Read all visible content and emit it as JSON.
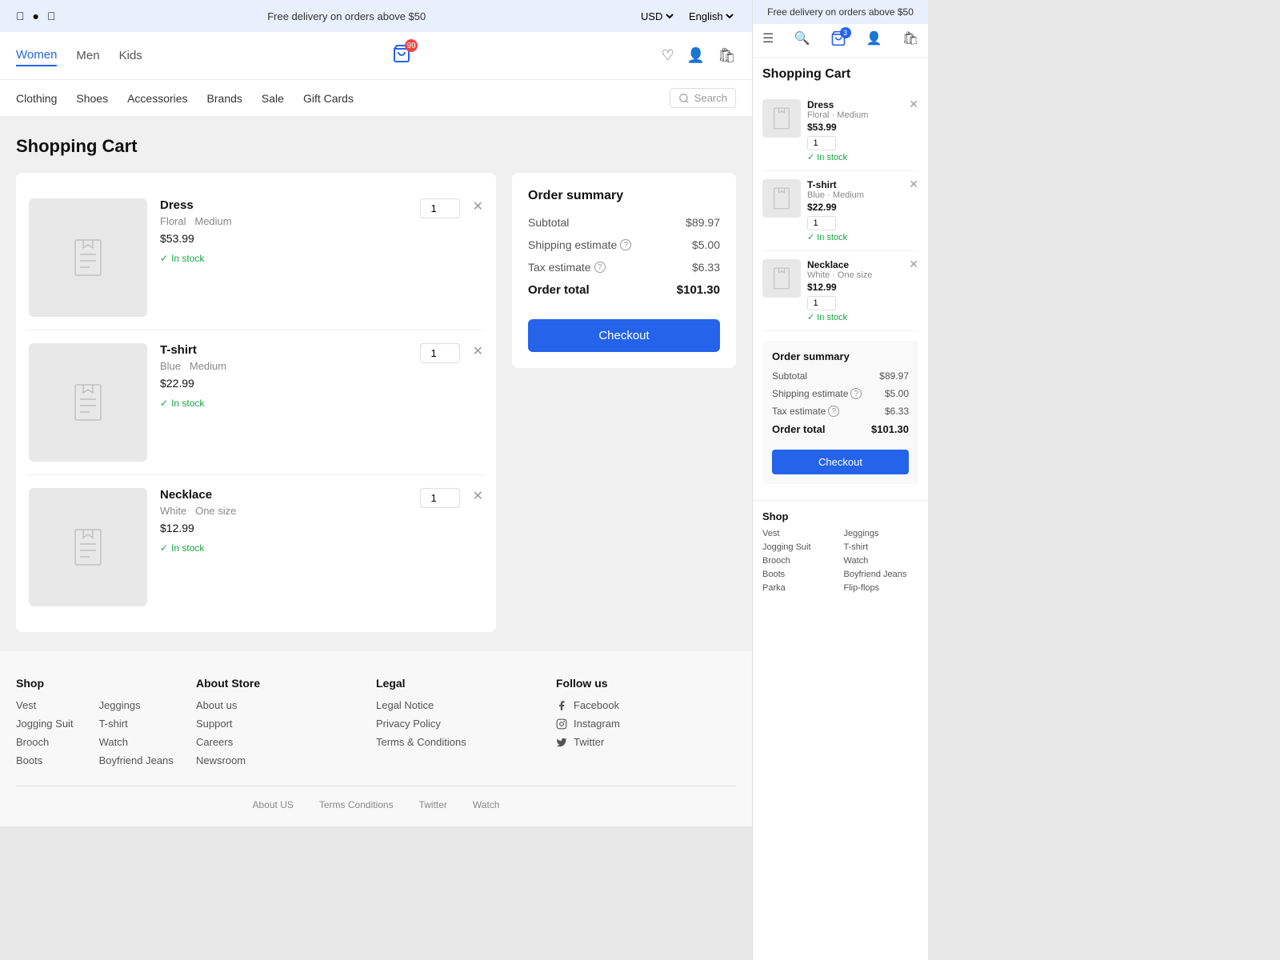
{
  "topbar": {
    "promo": "Free delivery on orders above $50",
    "currency": "USD",
    "language": "English",
    "social": [
      "facebook",
      "instagram",
      "twitter"
    ]
  },
  "nav": {
    "tabs": [
      "Women",
      "Men",
      "Kids"
    ],
    "active_tab": "Women",
    "cart_count": "99"
  },
  "categories": {
    "links": [
      "Clothing",
      "Shoes",
      "Accessories",
      "Brands",
      "Sale",
      "Gift Cards"
    ],
    "search_placeholder": "Search"
  },
  "page": {
    "title": "Shopping Cart"
  },
  "cart_items": [
    {
      "id": 1,
      "name": "Dress",
      "color": "Floral",
      "size": "Medium",
      "price": "$53.99",
      "qty": "1",
      "stock": "In stock"
    },
    {
      "id": 2,
      "name": "T-shirt",
      "color": "Blue",
      "size": "Medium",
      "price": "$22.99",
      "qty": "1",
      "stock": "In stock"
    },
    {
      "id": 3,
      "name": "Necklace",
      "color": "White",
      "size": "One size",
      "price": "$12.99",
      "qty": "1",
      "stock": "In stock"
    }
  ],
  "order_summary": {
    "title": "Order summary",
    "subtotal_label": "Subtotal",
    "subtotal_value": "$89.97",
    "shipping_label": "Shipping estimate",
    "shipping_value": "$5.00",
    "tax_label": "Tax estimate",
    "tax_value": "$6.33",
    "total_label": "Order total",
    "total_value": "$101.30",
    "checkout_label": "Checkout"
  },
  "footer": {
    "shop_title": "Shop",
    "shop_col1": [
      "Vest",
      "Jogging Suit",
      "Brooch",
      "Boots"
    ],
    "shop_col2": [
      "Jeggings",
      "T-shirt",
      "Watch",
      "Boyfriend Jeans"
    ],
    "about_title": "About Store",
    "about_links": [
      "About us",
      "Support",
      "Careers",
      "Newsroom"
    ],
    "legal_title": "Legal",
    "legal_links": [
      "Legal Notice",
      "Privacy Policy",
      "Terms & Conditions"
    ],
    "follow_title": "Follow us",
    "follow_links": [
      "Facebook",
      "Instagram",
      "Twitter"
    ],
    "bottom_links": [
      "About US",
      "Terms Conditions",
      "Twitter",
      "Watch"
    ]
  },
  "sidebar": {
    "promo": "Free delivery on orders above $50",
    "title": "Shopping Cart",
    "items": [
      {
        "name": "Dress",
        "color": "Floral",
        "size": "Medium",
        "price": "$53.99",
        "qty": "1",
        "stock": "In stock"
      },
      {
        "name": "T-shirt",
        "color": "Blue",
        "size": "Medium",
        "price": "$22.99",
        "qty": "1",
        "stock": "In stock"
      },
      {
        "name": "Necklace",
        "color": "White",
        "size": "One size",
        "price": "$12.99",
        "qty": "1",
        "stock": "In stock"
      }
    ],
    "order_summary": {
      "title": "Order summary",
      "subtotal_label": "Subtotal",
      "subtotal_value": "$89.97",
      "shipping_label": "Shipping estimate",
      "shipping_value": "$5.00",
      "tax_label": "Tax estimate",
      "tax_value": "$6.33",
      "total_label": "Order total",
      "total_value": "$101.30",
      "checkout_label": "Checkout"
    },
    "footer_shop_title": "Shop",
    "footer_col1": [
      "Vest",
      "Jogging Suit",
      "Brooch",
      "Boots",
      "Parka"
    ],
    "footer_col2": [
      "Jeggings",
      "T-shirt",
      "Watch",
      "Boyfriend Jeans",
      "Flip-flops"
    ]
  }
}
